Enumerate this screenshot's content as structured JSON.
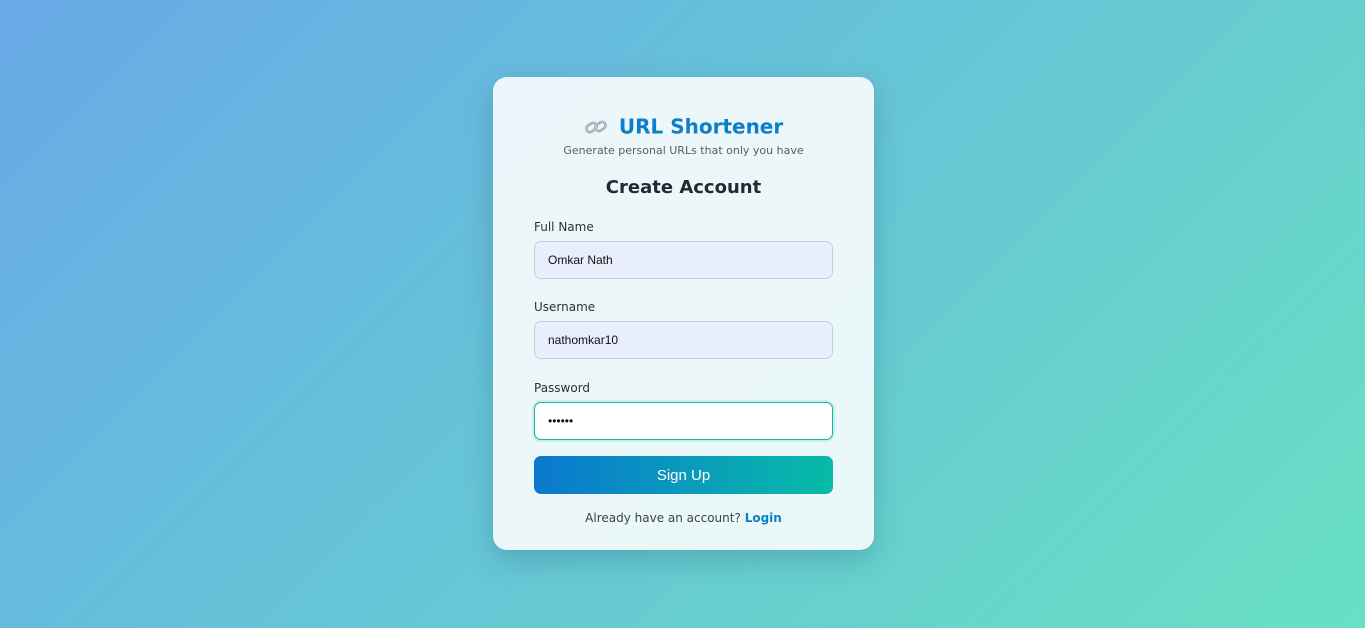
{
  "brand": {
    "icon": "link-icon",
    "title": "URL Shortener",
    "tagline": "Generate personal URLs that only you have"
  },
  "form": {
    "heading": "Create Account",
    "fields": {
      "full_name": {
        "label": "Full Name",
        "value": "Omkar Nath"
      },
      "username": {
        "label": "Username",
        "value": "nathomkar10"
      },
      "password": {
        "label": "Password",
        "value": "••••••"
      }
    },
    "submit_label": "Sign Up"
  },
  "footer": {
    "prompt": "Already have an account?",
    "login_link": "Login"
  },
  "colors": {
    "accent": "#0b7fcb",
    "accent_end": "#07bba8",
    "focus_border": "#12b5a0"
  }
}
